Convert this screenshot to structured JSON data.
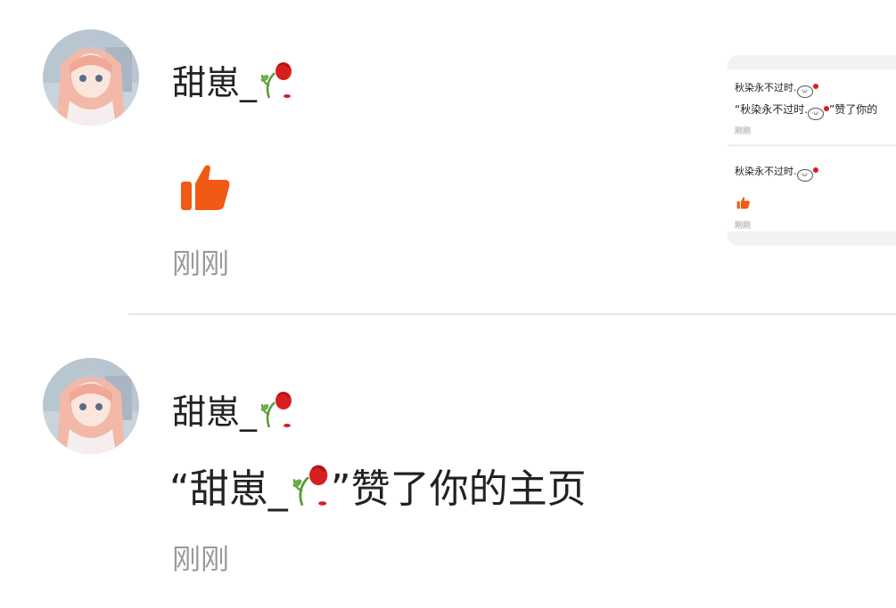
{
  "notifications": [
    {
      "user": "甜崽_",
      "action_icon": "thumbs-up-icon",
      "time": "刚刚"
    },
    {
      "user": "甜崽_",
      "message_prefix": "“甜崽_",
      "message_suffix": "”赞了你的主页",
      "time": "刚刚"
    }
  ],
  "preview": {
    "items": [
      {
        "name": "秋染永不过时.",
        "message_prefix": "“秋染永不过时.",
        "message_suffix": "”赞了你的",
        "time": "刚刚"
      },
      {
        "name": "秋染永不过时.",
        "action_icon": "thumbs-up-icon",
        "time": "刚刚"
      }
    ]
  },
  "colors": {
    "accent_orange": "#f05a14",
    "rose_red": "#d62020",
    "stem_green": "#5a9a3a",
    "time_gray": "#9a9a9a",
    "divider": "#e6e6e6"
  }
}
